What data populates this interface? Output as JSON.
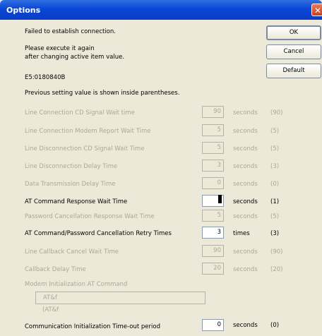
{
  "window": {
    "title": "Options",
    "close": "✕"
  },
  "messages": {
    "line1": "Failed to establish connection.",
    "line2": "Please execute it again",
    "line3": "after changing active item value.",
    "code": "E5:0180840B",
    "note": "Previous setting value is shown inside parentheses."
  },
  "buttons": {
    "ok": "OK",
    "cancel": "Cancel",
    "default": "Default"
  },
  "rows": [
    {
      "label": "Line Connection CD Signal Wait time",
      "value": "90",
      "unit": "seconds",
      "prev": "(90)",
      "enabled": false
    },
    {
      "label": "Line Connection Modem Report Wait Time",
      "value": "5",
      "unit": "seconds",
      "prev": "(5)",
      "enabled": false
    },
    {
      "label": "Line Disconnection CD Signal Wait Time",
      "value": "5",
      "unit": "seconds",
      "prev": "(5)",
      "enabled": false
    },
    {
      "label": "Line Disconnection Delay Time",
      "value": "3",
      "unit": "seconds",
      "prev": "(3)",
      "enabled": false
    },
    {
      "label": "Data Transmission Delay Time",
      "value": "0",
      "unit": "seconds",
      "prev": "(0)",
      "enabled": false
    },
    {
      "label": "AT Command Response Wait Time",
      "value": "",
      "unit": "seconds",
      "prev": "(1)",
      "enabled": true
    },
    {
      "label": "Password Cancellation Response Wait Time",
      "value": "5",
      "unit": "seconds",
      "prev": "(5)",
      "enabled": false
    },
    {
      "label": "AT Command/Password Cancellation Retry Times",
      "value": "3",
      "unit": "times",
      "prev": "(3)",
      "enabled": true
    },
    {
      "label": "Line Callback Cancel Wait Time",
      "value": "90",
      "unit": "seconds",
      "prev": "(90)",
      "enabled": false
    },
    {
      "label": "Callback Delay Time",
      "value": "20",
      "unit": "seconds",
      "prev": "(20)",
      "enabled": false
    }
  ],
  "modem": {
    "label": "Modem Initialization AT Command",
    "value": "AT&f",
    "prev": "(AT&f"
  },
  "last_row": {
    "label": "Communication Initialization Time-out period",
    "value": "0",
    "unit": "seconds",
    "prev": "(0)"
  }
}
